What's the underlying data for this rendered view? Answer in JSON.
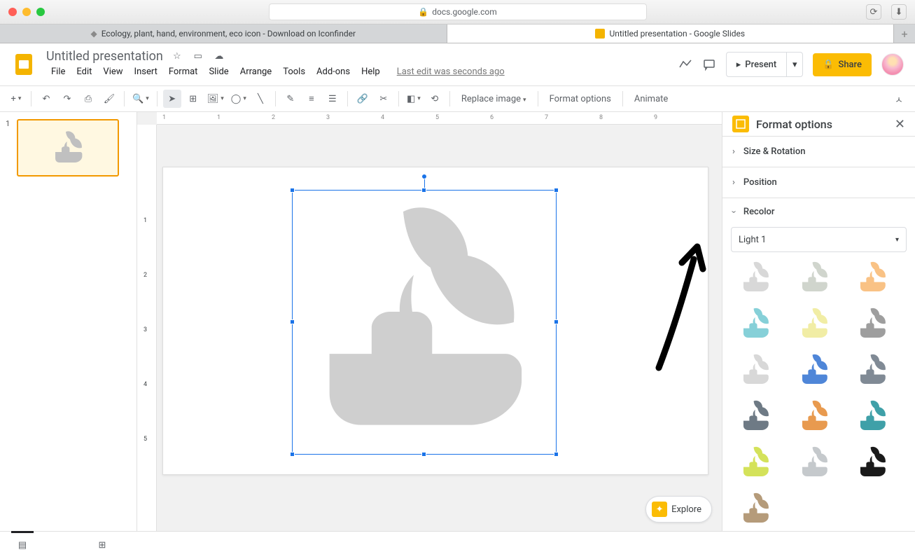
{
  "browser": {
    "url": "docs.google.com",
    "tab1": "Ecology, plant, hand, environment, eco icon - Download on Iconfinder",
    "tab2": "Untitled presentation - Google Slides"
  },
  "doc": {
    "title": "Untitled presentation",
    "last_edit": "Last edit was seconds ago"
  },
  "menus": [
    "File",
    "Edit",
    "View",
    "Insert",
    "Format",
    "Slide",
    "Arrange",
    "Tools",
    "Add-ons",
    "Help"
  ],
  "header": {
    "present": "Present",
    "share": "Share"
  },
  "toolbar": {
    "replace_image": "Replace image",
    "format_options": "Format options",
    "animate": "Animate"
  },
  "thumb_num": "1",
  "explore": "Explore",
  "panel": {
    "title": "Format options",
    "size_rotation": "Size & Rotation",
    "position": "Position",
    "recolor": "Recolor",
    "recolor_value": "Light 1"
  },
  "ruler_h": [
    "1",
    "1",
    "2",
    "3",
    "4",
    "5",
    "6",
    "7",
    "8",
    "9"
  ],
  "ruler_v": [
    "1",
    "2",
    "3",
    "4",
    "5"
  ],
  "swatch_colors": [
    "#d8d8d8",
    "#d0d5cd",
    "#f9c285",
    "#86d0d8",
    "#f1eda5",
    "#9e9e9e",
    "#d8d8d8",
    "#4f86d8",
    "#808a95",
    "#6e7a85",
    "#e89a4f",
    "#3fa0a8",
    "#d4e25a",
    "#c5c9cc",
    "#1a1a1a",
    "#b59b7a"
  ]
}
